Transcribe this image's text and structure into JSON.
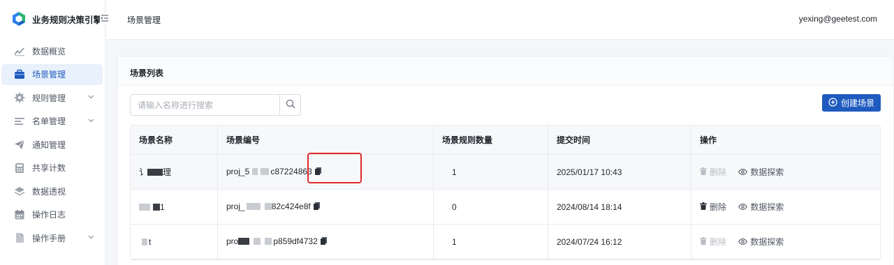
{
  "app": {
    "brand_name": "业务规则决策引擎"
  },
  "sidebar": {
    "items": [
      {
        "label": "数据概览",
        "icon": "chart-trend-icon",
        "active": false,
        "has_children": false
      },
      {
        "label": "场景管理",
        "icon": "briefcase-icon",
        "active": true,
        "has_children": false
      },
      {
        "label": "规则管理",
        "icon": "gear-icon",
        "active": false,
        "has_children": true
      },
      {
        "label": "名单管理",
        "icon": "list-icon",
        "active": false,
        "has_children": true
      },
      {
        "label": "通知管理",
        "icon": "paper-plane-icon",
        "active": false,
        "has_children": false
      },
      {
        "label": "共享计数",
        "icon": "calculator-icon",
        "active": false,
        "has_children": false
      },
      {
        "label": "数据透视",
        "icon": "layers-icon",
        "active": false,
        "has_children": false
      },
      {
        "label": "操作日志",
        "icon": "calendar-icon",
        "active": false,
        "has_children": false
      },
      {
        "label": "操作手册",
        "icon": "document-icon",
        "active": false,
        "has_children": true
      }
    ]
  },
  "header": {
    "title": "场景管理",
    "user": "yexing@geetest.com"
  },
  "card": {
    "title": "场景列表",
    "search_placeholder": "请输入名称进行搜索",
    "create_label": "创建场景"
  },
  "table": {
    "columns": [
      "场景名称",
      "场景编号",
      "场景规则数量",
      "提交时间",
      "操作"
    ],
    "rows": [
      {
        "name_prefix": "讠",
        "name_suffix": "理",
        "code_prefix": "proj_5",
        "code_suffix": "c87224863",
        "count": "1",
        "time": "2025/01/17 10:43",
        "delete_enabled": false
      },
      {
        "name_prefix": "",
        "name_suffix": "1",
        "code_prefix": "proj_",
        "code_suffix": "82c424e8f",
        "count": "0",
        "time": "2024/08/14 18:14",
        "delete_enabled": true
      },
      {
        "name_prefix": "",
        "name_suffix": "t",
        "code_prefix": "pro",
        "code_suffix": "p859df4732",
        "count": "1",
        "time": "2024/07/24 16:12",
        "delete_enabled": false
      }
    ],
    "action_delete": "删除",
    "action_explore": "数据探索"
  },
  "colors": {
    "accent": "#1f5bbf",
    "link": "#1f8ce0",
    "highlight": "#e02a2a"
  }
}
